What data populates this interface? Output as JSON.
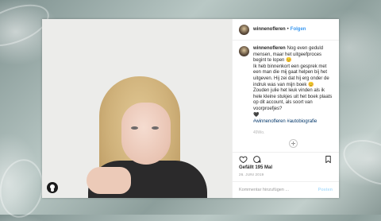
{
  "post": {
    "username": "winnenofleren",
    "dot": "•",
    "follow_label": "Folgen",
    "caption_lines": [
      "Nog even geduld mensen, maar het uitgeefproces begint te lopen 😊",
      "Ik heb binnenkort een gesprek met een man die mij gaat helpen bij het uitgeven. Hij zei dat hij erg onder de indruk was van mijn boek 😊",
      "Zouden julie het leuk vinden als ik hele kleine stukjes uit het boek plaats op dit account, als soort van voorproefjes?",
      "🖤"
    ],
    "hashtags": "#winnenofleren #autobiografie",
    "edited_note": "49Wo.",
    "likes": "Gefällt 195 Mal",
    "date": "26. JUNI 2019",
    "comment_placeholder": "Kommentar hinzufügen ...",
    "post_label": "Posten"
  },
  "icons": {
    "like": "heart-icon",
    "comment": "speech-bubble-icon",
    "share": "paper-plane-icon",
    "save": "bookmark-icon",
    "more": "plus-circle-icon",
    "user_tags": "person-icon"
  },
  "colors": {
    "link": "#3897f0",
    "hashtag": "#003569",
    "post_disabled": "#b2dffc",
    "muted": "#999999"
  }
}
